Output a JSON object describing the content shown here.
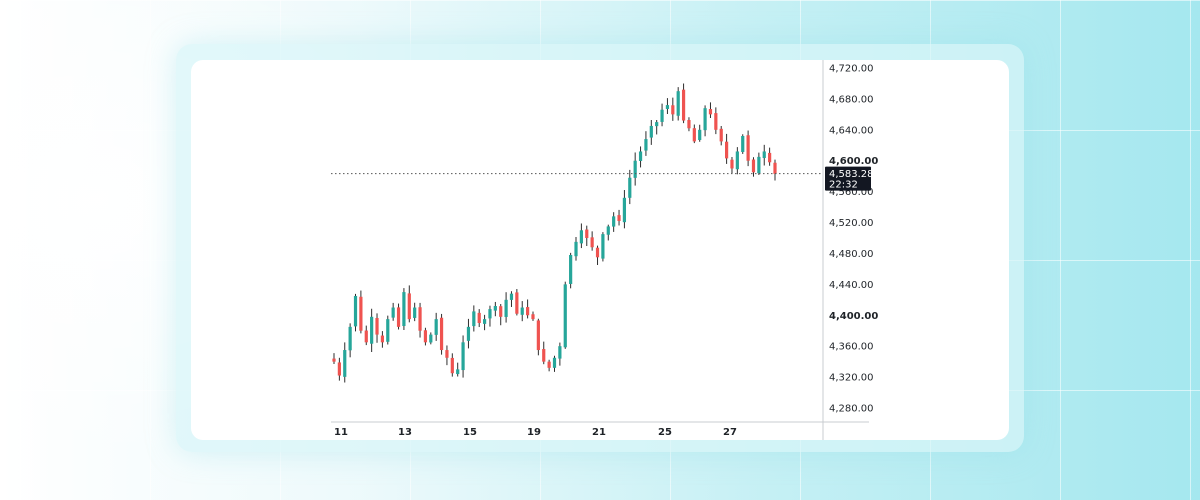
{
  "colors": {
    "up": "#26a69a",
    "down": "#ef5350",
    "wick": "#2d2d2d",
    "axis": "#c9ccd1",
    "label_bg": "#131722",
    "label_text": "#ffffff"
  },
  "chart_data": {
    "type": "candlestick",
    "title": "",
    "xlabel": "",
    "ylabel": "",
    "ylim": [
      4260,
      4730
    ],
    "yticks": [
      "4,720.00",
      "4,680.00",
      "4,640.00",
      "4,600.00",
      "4,560.00",
      "4,520.00",
      "4,480.00",
      "4,440.00",
      "4,400.00",
      "4,360.00",
      "4,320.00",
      "4,280.00"
    ],
    "yticks_bold": [
      "4,600.00",
      "4,400.00"
    ],
    "ytick_values": [
      4720,
      4680,
      4640,
      4600,
      4560,
      4520,
      4480,
      4440,
      4400,
      4360,
      4320,
      4280
    ],
    "xticks": [
      "11",
      "13",
      "15",
      "19",
      "21",
      "25",
      "27"
    ],
    "grid": false,
    "current_price": 4583.28,
    "current_price_label": "4,583.28",
    "countdown_label": "22:32",
    "price_line_style": "dotted",
    "close_path": [
      4340,
      4322,
      4355,
      4385,
      4425,
      4380,
      4365,
      4398,
      4375,
      4365,
      4395,
      4410,
      4385,
      4430,
      4395,
      4410,
      4380,
      4365,
      4375,
      4395,
      4355,
      4345,
      4325,
      4330,
      4365,
      4385,
      4405,
      4390,
      4395,
      4408,
      4412,
      4398,
      4420,
      4428,
      4402,
      4410,
      4400,
      4395,
      4355,
      4340,
      4332,
      4345,
      4360,
      4440,
      4478,
      4495,
      4510,
      4500,
      4488,
      4475,
      4505,
      4515,
      4528,
      4522,
      4552,
      4578,
      4600,
      4612,
      4628,
      4645,
      4650,
      4666,
      4672,
      4660,
      4690,
      4652,
      4642,
      4625,
      4640,
      4668,
      4660,
      4640,
      4625,
      4603,
      4590,
      4612,
      4632,
      4600,
      4585,
      4605,
      4612,
      4598,
      4583
    ]
  }
}
